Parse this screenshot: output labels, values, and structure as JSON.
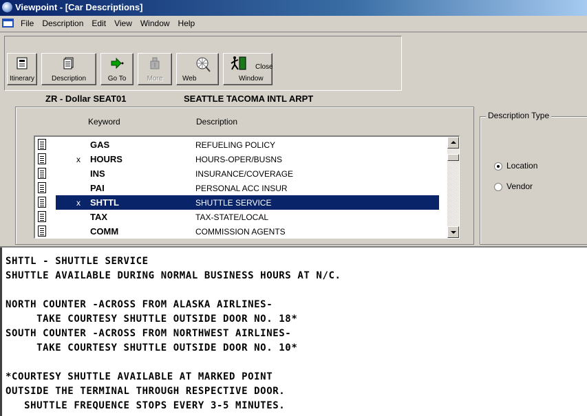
{
  "window": {
    "title": "Viewpoint - [Car Descriptions]"
  },
  "menu": [
    "File",
    "Description",
    "Edit",
    "View",
    "Window",
    "Help"
  ],
  "toolbar": {
    "itinerary": "Itinerary",
    "description": "Description",
    "goto": "Go To",
    "more": "More",
    "web": "Web",
    "close": "Close",
    "window": "Window"
  },
  "header": {
    "location": "ZR - Dollar SEAT01",
    "airport": "SEATTLE TACOMA INTL ARPT"
  },
  "list": {
    "col_keyword": "Keyword",
    "col_description": "Description",
    "rows": [
      {
        "mark": "",
        "keyword": "GAS",
        "description": "REFUELING POLICY"
      },
      {
        "mark": "x",
        "keyword": "HOURS",
        "description": "HOURS-OPER/BUSNS"
      },
      {
        "mark": "",
        "keyword": "INS",
        "description": "INSURANCE/COVERAGE"
      },
      {
        "mark": "",
        "keyword": "PAI",
        "description": "PERSONAL ACC INSUR"
      },
      {
        "mark": "x",
        "keyword": "SHTTL",
        "description": "SHUTTLE SERVICE"
      },
      {
        "mark": "",
        "keyword": "TAX",
        "description": "TAX-STATE/LOCAL"
      },
      {
        "mark": "",
        "keyword": "COMM",
        "description": "COMMISSION AGENTS"
      }
    ],
    "selected_index": 4
  },
  "description_type": {
    "legend": "Description Type",
    "options": [
      "Location",
      "Vendor"
    ],
    "selected": "Location"
  },
  "text_lines": [
    "SHTTL - SHUTTLE SERVICE",
    "SHUTTLE AVAILABLE DURING NORMAL BUSINESS HOURS AT N/C.",
    "",
    "NORTH COUNTER -ACROSS FROM ALASKA AIRLINES-",
    "     TAKE COURTESY SHUTTLE OUTSIDE DOOR NO. 18*",
    "SOUTH COUNTER -ACROSS FROM NORTHWEST AIRLINES-",
    "     TAKE COURTESY SHUTTLE OUTSIDE DOOR NO. 10*",
    "",
    "*COURTESY SHUTTLE AVAILABLE AT MARKED POINT",
    "OUTSIDE THE TERMINAL THROUGH RESPECTIVE DOOR.",
    "   SHUTTLE FREQUENCE STOPS EVERY 3-5 MINUTES."
  ]
}
